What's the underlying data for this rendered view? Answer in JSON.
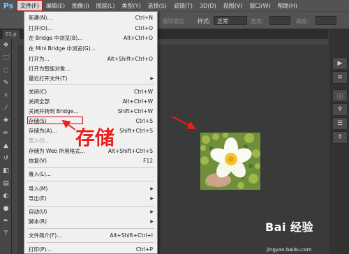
{
  "app": {
    "logo_text": "Ps"
  },
  "menubar": {
    "items": [
      {
        "label": "文件(F)",
        "active": true
      },
      {
        "label": "编辑(E)"
      },
      {
        "label": "图像(I)"
      },
      {
        "label": "图层(L)"
      },
      {
        "label": "类型(Y)"
      },
      {
        "label": "选择(S)"
      },
      {
        "label": "滤镜(T)"
      },
      {
        "label": "3D(D)"
      },
      {
        "label": "视图(V)"
      },
      {
        "label": "窗口(W)"
      },
      {
        "label": "帮助(H)"
      }
    ]
  },
  "options_bar": {
    "antialias_label": "消除锯齿",
    "style_label": "样式:",
    "style_value": "正常",
    "width_label": "宽度:",
    "height_label": "高度:"
  },
  "document_tab": {
    "label": "01.p"
  },
  "file_menu": {
    "items": [
      {
        "label": "新建(N)...",
        "shortcut": "Ctrl+N"
      },
      {
        "label": "打开(O)...",
        "shortcut": "Ctrl+O"
      },
      {
        "label": "在 Bridge 中浏览(B)...",
        "shortcut": "Alt+Ctrl+O"
      },
      {
        "label": "在 Mini Bridge 中浏览(G)...",
        "shortcut": ""
      },
      {
        "label": "打开为...",
        "shortcut": "Alt+Shift+Ctrl+O"
      },
      {
        "label": "打开为智能对象...",
        "shortcut": ""
      },
      {
        "label": "最近打开文件(T)",
        "shortcut": "",
        "submenu": true
      },
      {
        "label": "关闭(C)",
        "shortcut": "Ctrl+W"
      },
      {
        "label": "关闭全部",
        "shortcut": "Alt+Ctrl+W"
      },
      {
        "label": "关闭并转到 Bridge...",
        "shortcut": "Shift+Ctrl+W"
      },
      {
        "label": "存储(S)",
        "shortcut": "Ctrl+S",
        "highlighted": true
      },
      {
        "label": "存储为(A)...",
        "shortcut": "Shift+Ctrl+S"
      },
      {
        "label": "签入(I)...",
        "shortcut": "",
        "disabled": true
      },
      {
        "label": "存储为 Web 所用格式...",
        "shortcut": "Alt+Shift+Ctrl+S"
      },
      {
        "label": "恢复(V)",
        "shortcut": "F12"
      },
      {
        "label": "置入(L)...",
        "shortcut": ""
      },
      {
        "label": "导入(M)",
        "shortcut": "",
        "submenu": true
      },
      {
        "label": "导出(E)",
        "shortcut": "",
        "submenu": true
      },
      {
        "label": "自动(U)",
        "shortcut": "",
        "submenu": true
      },
      {
        "label": "脚本(R)",
        "shortcut": "",
        "submenu": true
      },
      {
        "label": "文件简介(F)...",
        "shortcut": "Alt+Shift+Ctrl+I"
      },
      {
        "label": "打印(P)...",
        "shortcut": "Ctrl+P"
      }
    ],
    "submenu_arrow": "▶"
  },
  "annotation": {
    "callout_text": "存储",
    "accent_color": "#e8201b"
  },
  "watermark": {
    "brand": "Bai 经验",
    "url": "jingyan.baidu.com"
  }
}
